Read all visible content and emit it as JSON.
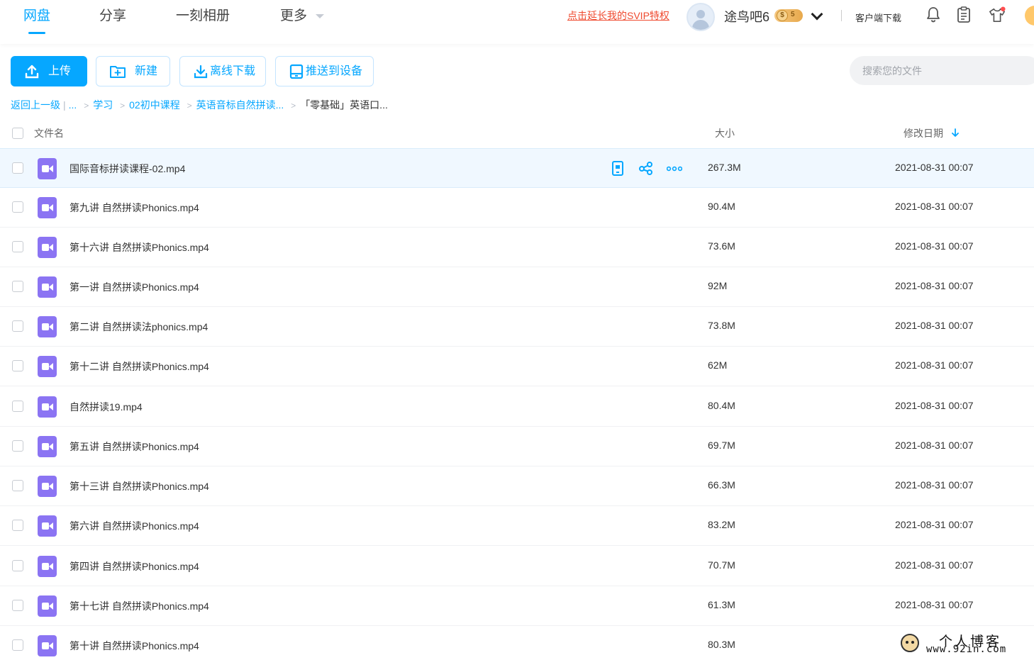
{
  "nav": {
    "tabs": [
      "网盘",
      "分享",
      "一刻相册",
      "更多"
    ],
    "svip_link": "点击延长我的SVIP特权",
    "username": "途鸟吧6",
    "vip_coin": "$",
    "vip_level": "5",
    "client_download": "客户端下载"
  },
  "toolbar": {
    "upload": "上传",
    "new": "新建",
    "offline_download": "离线下载",
    "push_to_device": "推送到设备",
    "search_placeholder": "搜索您的文件"
  },
  "breadcrumb": {
    "back": "返回上一级",
    "bar": "|",
    "ellipsis": "...",
    "sep": ">",
    "items": [
      "学习",
      "02初中课程",
      "英语音标自然拼读...",
      "「零基础」英语口..."
    ]
  },
  "table": {
    "headers": {
      "name": "文件名",
      "size": "大小",
      "date": "修改日期"
    },
    "rows": [
      {
        "name": "国际音标拼读课程-02.mp4",
        "size": "267.3M",
        "date": "2021-08-31 00:07"
      },
      {
        "name": "第九讲 自然拼读Phonics.mp4",
        "size": "90.4M",
        "date": "2021-08-31 00:07"
      },
      {
        "name": "第十六讲 自然拼读Phonics.mp4",
        "size": "73.6M",
        "date": "2021-08-31 00:07"
      },
      {
        "name": "第一讲 自然拼读Phonics.mp4",
        "size": "92M",
        "date": "2021-08-31 00:07"
      },
      {
        "name": "第二讲 自然拼读法phonics.mp4",
        "size": "73.8M",
        "date": "2021-08-31 00:07"
      },
      {
        "name": "第十二讲 自然拼读Phonics.mp4",
        "size": "62M",
        "date": "2021-08-31 00:07"
      },
      {
        "name": "自然拼读19.mp4",
        "size": "80.4M",
        "date": "2021-08-31 00:07"
      },
      {
        "name": "第五讲 自然拼读Phonics.mp4",
        "size": "69.7M",
        "date": "2021-08-31 00:07"
      },
      {
        "name": "第十三讲 自然拼读Phonics.mp4",
        "size": "66.3M",
        "date": "2021-08-31 00:07"
      },
      {
        "name": "第六讲 自然拼读Phonics.mp4",
        "size": "83.2M",
        "date": "2021-08-31 00:07"
      },
      {
        "name": "第四讲 自然拼读Phonics.mp4",
        "size": "70.7M",
        "date": "2021-08-31 00:07"
      },
      {
        "name": "第十七讲 自然拼读Phonics.mp4",
        "size": "61.3M",
        "date": "2021-08-31 00:07"
      },
      {
        "name": "第十讲 自然拼读Phonics.mp4",
        "size": "80.3M",
        "date": ""
      }
    ]
  },
  "watermark": {
    "line1": "个人博客",
    "line2": "www.92in.com"
  },
  "icons": {
    "file": "video-file-icon",
    "row_actions": [
      "phone-push-icon",
      "share-icon",
      "more-icon"
    ],
    "top": [
      "bell-icon",
      "clipboard-icon",
      "tshirt-icon"
    ]
  },
  "colors": {
    "accent": "#06a7ff",
    "svip": "#ef4a2f",
    "video_icon": "#8b74f3"
  }
}
